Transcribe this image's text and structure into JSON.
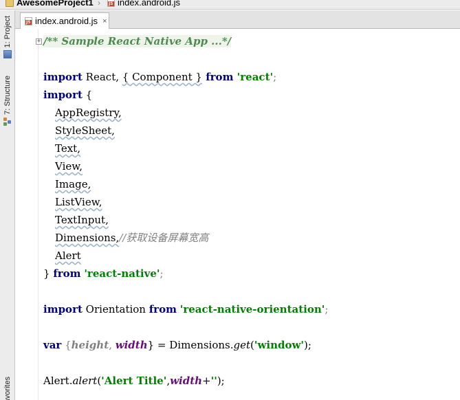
{
  "breadcrumb": {
    "project": "AwesomeProject1",
    "file": "index.android.js"
  },
  "toolwindows": {
    "project": "1: Project",
    "structure": "7: Structure",
    "favorites": "Favorites"
  },
  "editor": {
    "active_tab": "index.android.js",
    "close_glyph": "×"
  },
  "code": {
    "l1": "/** Sample React Native App ...*/",
    "l3_kw": "import",
    "l3_a": " React, ",
    "l3_b": "{ Component }",
    "l3_kw2": " from ",
    "l3_str": "'react'",
    "l3_end": ";",
    "l4_kw": "import",
    "l4_rest": " {",
    "l5": "AppRegistry,",
    "l6": "StyleSheet,",
    "l7": "Text,",
    "l8": "View,",
    "l9": "Image,",
    "l10": "ListView,",
    "l11": "TextInput,",
    "l12_a": "Dimensions,",
    "l12_cmt": "//获取设备屏幕宽高",
    "l13": "Alert",
    "l14_a": "} ",
    "l14_kw": "from",
    "l14_sp": " ",
    "l14_str": "'react-native'",
    "l14_end": ";",
    "l16_kw": "import",
    "l16_a": " Orientation ",
    "l16_kw2": "from",
    "l16_sp": " ",
    "l16_str": "'react-native-orientation'",
    "l16_end": ";",
    "l18_kw": "var",
    "l18_a": " {",
    "l18_v1": "height",
    "l18_b": ", ",
    "l18_v2": "width",
    "l18_c": "} = Dimensions.",
    "l18_fn": "get",
    "l18_d": "(",
    "l18_str": "'window'",
    "l18_e": ");",
    "l20_a": "Alert.",
    "l20_fn": "alert",
    "l20_b": "(",
    "l20_str": "'Alert Title'",
    "l20_c": ",",
    "l20_v": "width",
    "l20_d": "+",
    "l20_str2": "''",
    "l20_e": ");"
  },
  "colors": {
    "keyword": "#000080",
    "string": "#008000",
    "comment": "#808080",
    "variable": "#660e7a"
  }
}
